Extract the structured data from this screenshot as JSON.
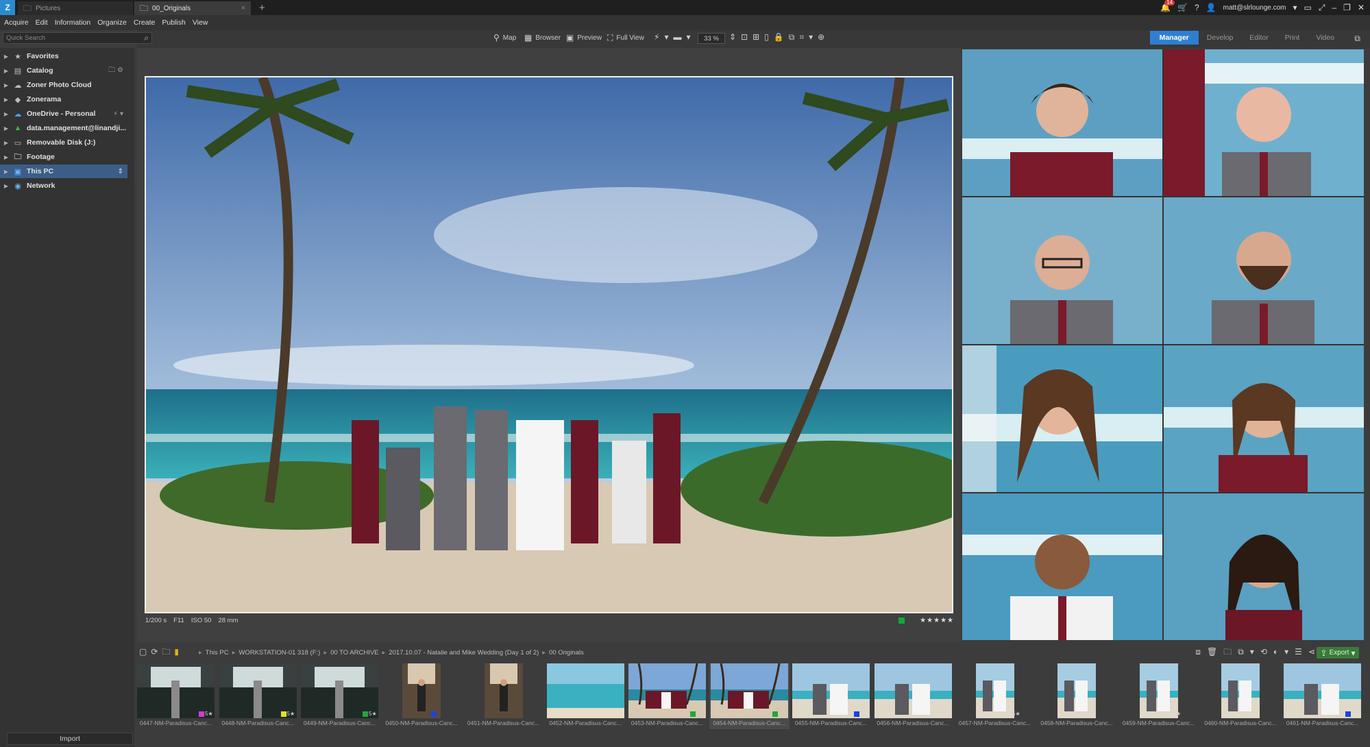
{
  "titlebar": {
    "tabs": [
      {
        "label": "Pictures",
        "icon": "folder-icon"
      },
      {
        "label": "00_Originals",
        "icon": "folder-icon"
      }
    ],
    "new_tab": "+",
    "notification_count": "14",
    "account": "matt@slrlounge.com"
  },
  "menu": [
    "Acquire",
    "Edit",
    "Information",
    "Organize",
    "Create",
    "Publish",
    "View"
  ],
  "search": {
    "placeholder": "Quick Search"
  },
  "toolbar": {
    "map": "Map",
    "browser": "Browser",
    "preview": "Preview",
    "full_view": "Full View",
    "zoom": "33 %"
  },
  "modes": [
    "Manager",
    "Develop",
    "Editor",
    "Print",
    "Video"
  ],
  "sidebar": [
    {
      "label": "Favorites",
      "icon": "star-icon"
    },
    {
      "label": "Catalog",
      "icon": "catalog-icon"
    },
    {
      "label": "Zoner Photo Cloud",
      "icon": "cloud-icon"
    },
    {
      "label": "Zonerama",
      "icon": "zonerama-icon"
    },
    {
      "label": "OneDrive - Personal",
      "icon": "onedrive-icon"
    },
    {
      "label": "data.management@linandji...",
      "icon": "google-drive-icon"
    },
    {
      "label": "Removable Disk (J:)",
      "icon": "disk-icon"
    },
    {
      "label": "Footage",
      "icon": "folder-icon"
    },
    {
      "label": "This PC",
      "icon": "pc-icon"
    },
    {
      "label": "Network",
      "icon": "network-icon"
    }
  ],
  "import_label": "Import",
  "photo_info": {
    "shutter": "1/200 s",
    "aperture": "F11",
    "iso": "ISO 50",
    "focal": "28 mm",
    "stars": "★★★★★",
    "color_label": "#13a83a"
  },
  "breadcrumb": [
    "This PC",
    "WORKSTATION-01 318 (F:)",
    "00 TO ARCHIVE",
    "2017.10.07 - Natalie and Mike Wedding (Day 1 of 2)",
    "00 Originals"
  ],
  "export_label": "Export",
  "filmstrip": [
    {
      "name": "0447-NM-Paradisus-Canc...",
      "label": "#d63ad0",
      "stars": "5★",
      "type": "hall"
    },
    {
      "name": "0448-NM-Paradisus-Canc...",
      "label": "#e6e020",
      "stars": "5★",
      "type": "hall"
    },
    {
      "name": "0449-NM-Paradisus-Canc...",
      "label": "#20a83a",
      "stars": "5★",
      "type": "hall"
    },
    {
      "name": "0450-NM-Paradisus-Canc...",
      "label": "#2040e0",
      "stars": "",
      "type": "portrait-hall"
    },
    {
      "name": "0451-NM-Paradisus-Canc...",
      "label": "",
      "stars": "",
      "type": "portrait-hall"
    },
    {
      "name": "0452-NM-Paradisus-Canc...",
      "label": "",
      "stars": "",
      "type": "sea"
    },
    {
      "name": "0453-NM-Paradisus-Canc...",
      "label": "#20a83a",
      "stars": "",
      "type": "group"
    },
    {
      "name": "0454-NM-Paradisus-Canc...",
      "label": "#20a83a",
      "stars": "",
      "type": "group"
    },
    {
      "name": "0455-NM-Paradisus-Canc...",
      "label": "#2040e0",
      "stars": "",
      "type": "couple"
    },
    {
      "name": "0456-NM-Paradisus-Canc...",
      "label": "",
      "stars": "",
      "type": "couple"
    },
    {
      "name": "0457-NM-Paradisus-Canc...",
      "label": "",
      "stars": "5★",
      "type": "portrait-couple"
    },
    {
      "name": "0458-NM-Paradisus-Canc...",
      "label": "",
      "stars": "",
      "type": "portrait-couple"
    },
    {
      "name": "0459-NM-Paradisus-Canc...",
      "label": "",
      "stars": "★",
      "type": "portrait-couple"
    },
    {
      "name": "0460-NM-Paradisus-Canc...",
      "label": "",
      "stars": "",
      "type": "portrait-couple"
    },
    {
      "name": "0461-NM-Paradisus-Canc...",
      "label": "#2040e0",
      "stars": "",
      "type": "couple"
    }
  ]
}
